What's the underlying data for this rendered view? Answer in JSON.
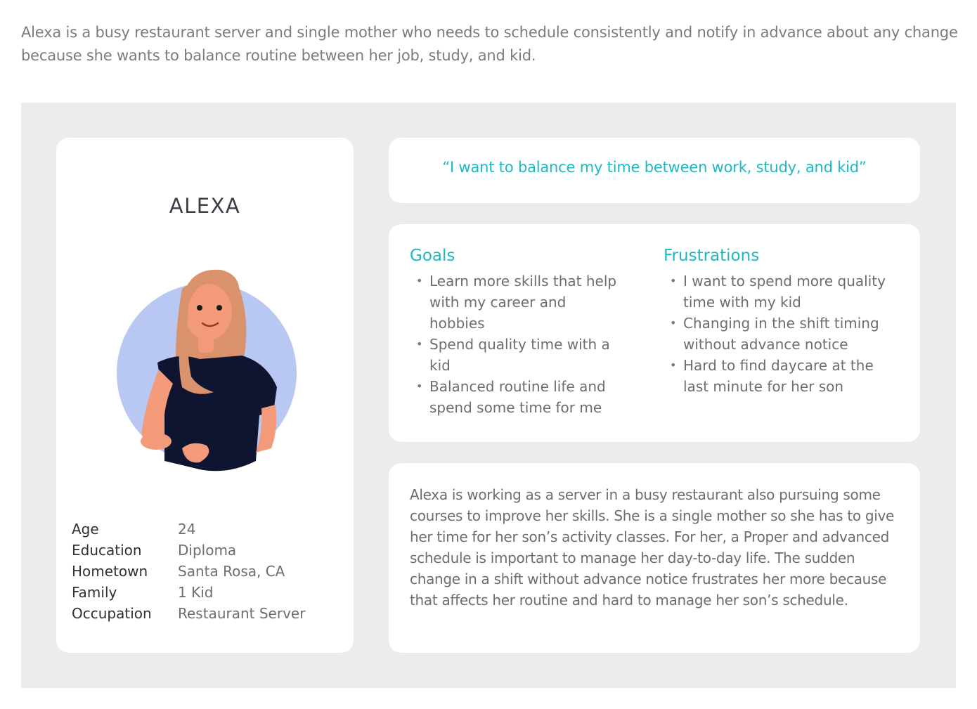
{
  "intro": "Alexa is a busy restaurant server and single mother who needs to schedule consistently and notify in advance about any change because she wants to balance routine between her job, study, and kid.",
  "profile": {
    "name": "ALEXA",
    "facts": [
      {
        "label": "Age",
        "value": "24"
      },
      {
        "label": "Education",
        "value": "Diploma"
      },
      {
        "label": "Hometown",
        "value": "Santa Rosa, CA"
      },
      {
        "label": "Family",
        "value": "1 Kid"
      },
      {
        "label": "Occupation",
        "value": "Restaurant Server"
      }
    ]
  },
  "quote": "“I want to balance my time between work, study, and kid”",
  "goals": {
    "title": "Goals",
    "items": [
      "Learn more skills that help with my career and hobbies",
      "Spend quality time with a kid",
      "Balanced routine life and spend some time for me"
    ]
  },
  "frustrations": {
    "title": "Frustrations",
    "items": [
      "I want to spend more quality time with my kid",
      "Changing in the shift timing without advance notice",
      "Hard to find daycare at the last minute for her son"
    ]
  },
  "bio": "Alexa is working as a server in a busy restaurant also pursuing some courses to improve her skills. She is a single mother so she has to give her time for her son’s activity classes. For her, a Proper and advanced schedule is important to manage her day-to-day life. The sudden change in a shift without advance notice frustrates her more because that affects her routine and hard to manage her son’s schedule.",
  "colors": {
    "accent": "#1fb8c2",
    "panel": "#ececec",
    "avatar_circle": "#b9c8f2",
    "shirt": "#0f1430",
    "skin": "#f39a7a",
    "hair": "#d9926c"
  }
}
